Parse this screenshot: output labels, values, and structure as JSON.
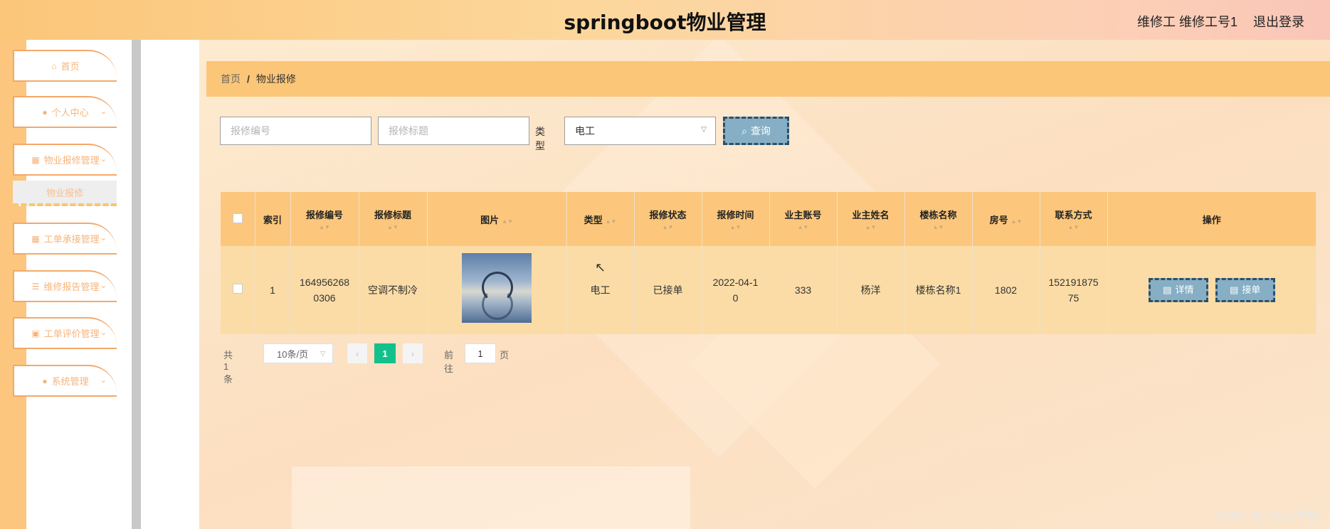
{
  "header": {
    "title": "springboot物业管理",
    "user": "维修工 维修工号1",
    "logout": "退出登录"
  },
  "sidebar": {
    "items": [
      {
        "label": "首页",
        "icon": "home-icon",
        "glyph": "⌂"
      },
      {
        "label": "个人中心",
        "icon": "user-icon",
        "glyph": "●"
      },
      {
        "label": "物业报修管理",
        "icon": "grid-icon",
        "glyph": "▦"
      },
      {
        "label": "工单承接管理",
        "icon": "grid-icon",
        "glyph": "▦"
      },
      {
        "label": "维修报告管理",
        "icon": "list-icon",
        "glyph": "☰"
      },
      {
        "label": "工单评价管理",
        "icon": "clipboard-icon",
        "glyph": "▣"
      },
      {
        "label": "系统管理",
        "icon": "user-icon",
        "glyph": "●"
      }
    ],
    "submenu": "物业报修"
  },
  "breadcrumb": {
    "home": "首页",
    "separator": "/",
    "current": "物业报修"
  },
  "search": {
    "no_placeholder": "报修编号",
    "title_placeholder": "报修标题",
    "type_label": "类型",
    "type_value": "电工",
    "query_label": "查询"
  },
  "table": {
    "headers": [
      "索引",
      "报修编号",
      "报修标题",
      "图片",
      "类型",
      "报修状态",
      "报修时间",
      "业主账号",
      "业主姓名",
      "楼栋名称",
      "房号",
      "联系方式",
      "操作"
    ],
    "rows": [
      {
        "index": "1",
        "no_line1": "164956268",
        "no_line2": "0306",
        "title": "空调不制冷",
        "type": "电工",
        "status": "已接单",
        "time_line1": "2022-04-1",
        "time_line2": "0",
        "owner_account": "333",
        "owner_name": "杨洋",
        "building": "楼栋名称1",
        "room": "1802",
        "phone_line1": "152191875",
        "phone_line2": "75",
        "actions": {
          "detail": "详情",
          "accept": "接单"
        }
      }
    ]
  },
  "pager": {
    "total": "共 1 条",
    "page_size": "10条/页",
    "current_page": "1",
    "goto_label": "前往",
    "goto_value": "1",
    "page_suffix": "页"
  },
  "watermark": "CSDN @小山山学姐",
  "colors": {
    "accent": "#fcc678",
    "button": "#86aec4",
    "button_border": "#2f4f64",
    "active_page": "#13c08c"
  }
}
